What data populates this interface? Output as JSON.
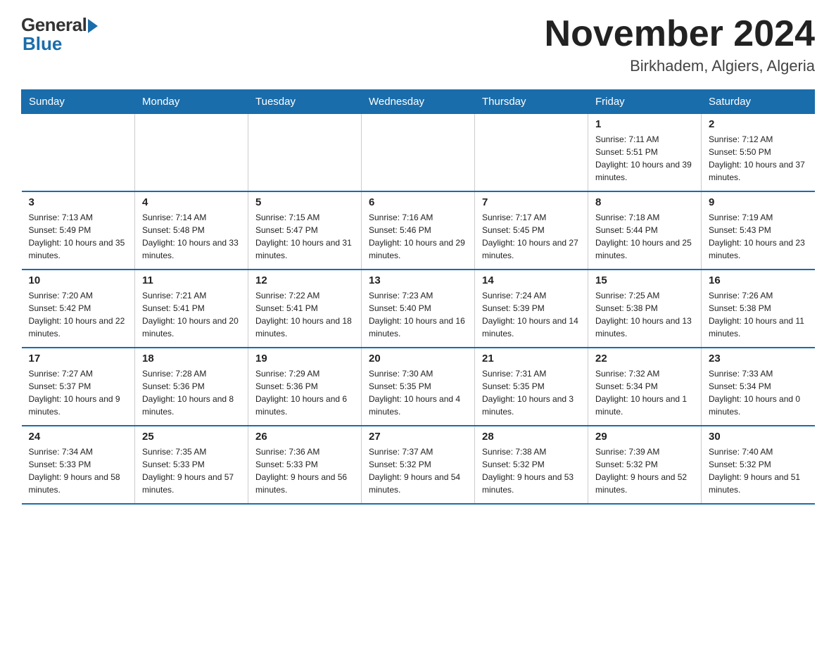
{
  "header": {
    "logo_general": "General",
    "logo_blue": "Blue",
    "title": "November 2024",
    "subtitle": "Birkhadem, Algiers, Algeria"
  },
  "weekdays": [
    "Sunday",
    "Monday",
    "Tuesday",
    "Wednesday",
    "Thursday",
    "Friday",
    "Saturday"
  ],
  "weeks": [
    [
      {
        "day": "",
        "info": ""
      },
      {
        "day": "",
        "info": ""
      },
      {
        "day": "",
        "info": ""
      },
      {
        "day": "",
        "info": ""
      },
      {
        "day": "",
        "info": ""
      },
      {
        "day": "1",
        "info": "Sunrise: 7:11 AM\nSunset: 5:51 PM\nDaylight: 10 hours and 39 minutes."
      },
      {
        "day": "2",
        "info": "Sunrise: 7:12 AM\nSunset: 5:50 PM\nDaylight: 10 hours and 37 minutes."
      }
    ],
    [
      {
        "day": "3",
        "info": "Sunrise: 7:13 AM\nSunset: 5:49 PM\nDaylight: 10 hours and 35 minutes."
      },
      {
        "day": "4",
        "info": "Sunrise: 7:14 AM\nSunset: 5:48 PM\nDaylight: 10 hours and 33 minutes."
      },
      {
        "day": "5",
        "info": "Sunrise: 7:15 AM\nSunset: 5:47 PM\nDaylight: 10 hours and 31 minutes."
      },
      {
        "day": "6",
        "info": "Sunrise: 7:16 AM\nSunset: 5:46 PM\nDaylight: 10 hours and 29 minutes."
      },
      {
        "day": "7",
        "info": "Sunrise: 7:17 AM\nSunset: 5:45 PM\nDaylight: 10 hours and 27 minutes."
      },
      {
        "day": "8",
        "info": "Sunrise: 7:18 AM\nSunset: 5:44 PM\nDaylight: 10 hours and 25 minutes."
      },
      {
        "day": "9",
        "info": "Sunrise: 7:19 AM\nSunset: 5:43 PM\nDaylight: 10 hours and 23 minutes."
      }
    ],
    [
      {
        "day": "10",
        "info": "Sunrise: 7:20 AM\nSunset: 5:42 PM\nDaylight: 10 hours and 22 minutes."
      },
      {
        "day": "11",
        "info": "Sunrise: 7:21 AM\nSunset: 5:41 PM\nDaylight: 10 hours and 20 minutes."
      },
      {
        "day": "12",
        "info": "Sunrise: 7:22 AM\nSunset: 5:41 PM\nDaylight: 10 hours and 18 minutes."
      },
      {
        "day": "13",
        "info": "Sunrise: 7:23 AM\nSunset: 5:40 PM\nDaylight: 10 hours and 16 minutes."
      },
      {
        "day": "14",
        "info": "Sunrise: 7:24 AM\nSunset: 5:39 PM\nDaylight: 10 hours and 14 minutes."
      },
      {
        "day": "15",
        "info": "Sunrise: 7:25 AM\nSunset: 5:38 PM\nDaylight: 10 hours and 13 minutes."
      },
      {
        "day": "16",
        "info": "Sunrise: 7:26 AM\nSunset: 5:38 PM\nDaylight: 10 hours and 11 minutes."
      }
    ],
    [
      {
        "day": "17",
        "info": "Sunrise: 7:27 AM\nSunset: 5:37 PM\nDaylight: 10 hours and 9 minutes."
      },
      {
        "day": "18",
        "info": "Sunrise: 7:28 AM\nSunset: 5:36 PM\nDaylight: 10 hours and 8 minutes."
      },
      {
        "day": "19",
        "info": "Sunrise: 7:29 AM\nSunset: 5:36 PM\nDaylight: 10 hours and 6 minutes."
      },
      {
        "day": "20",
        "info": "Sunrise: 7:30 AM\nSunset: 5:35 PM\nDaylight: 10 hours and 4 minutes."
      },
      {
        "day": "21",
        "info": "Sunrise: 7:31 AM\nSunset: 5:35 PM\nDaylight: 10 hours and 3 minutes."
      },
      {
        "day": "22",
        "info": "Sunrise: 7:32 AM\nSunset: 5:34 PM\nDaylight: 10 hours and 1 minute."
      },
      {
        "day": "23",
        "info": "Sunrise: 7:33 AM\nSunset: 5:34 PM\nDaylight: 10 hours and 0 minutes."
      }
    ],
    [
      {
        "day": "24",
        "info": "Sunrise: 7:34 AM\nSunset: 5:33 PM\nDaylight: 9 hours and 58 minutes."
      },
      {
        "day": "25",
        "info": "Sunrise: 7:35 AM\nSunset: 5:33 PM\nDaylight: 9 hours and 57 minutes."
      },
      {
        "day": "26",
        "info": "Sunrise: 7:36 AM\nSunset: 5:33 PM\nDaylight: 9 hours and 56 minutes."
      },
      {
        "day": "27",
        "info": "Sunrise: 7:37 AM\nSunset: 5:32 PM\nDaylight: 9 hours and 54 minutes."
      },
      {
        "day": "28",
        "info": "Sunrise: 7:38 AM\nSunset: 5:32 PM\nDaylight: 9 hours and 53 minutes."
      },
      {
        "day": "29",
        "info": "Sunrise: 7:39 AM\nSunset: 5:32 PM\nDaylight: 9 hours and 52 minutes."
      },
      {
        "day": "30",
        "info": "Sunrise: 7:40 AM\nSunset: 5:32 PM\nDaylight: 9 hours and 51 minutes."
      }
    ]
  ]
}
